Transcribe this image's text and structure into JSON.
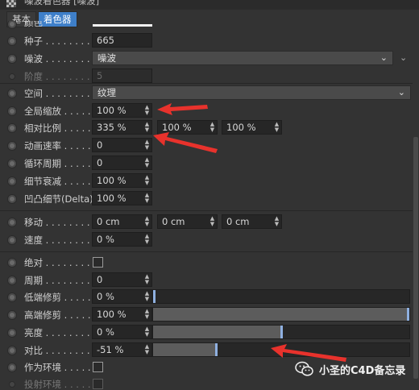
{
  "window": {
    "title": "噪波着色器 [噪波]"
  },
  "tabs": [
    {
      "label": "基本",
      "active": false
    },
    {
      "label": "着色器",
      "active": true
    }
  ],
  "params": {
    "color": {
      "label": "颜色"
    },
    "seed": {
      "label": "种子 . . . . . . . .",
      "value": "665"
    },
    "noise": {
      "label": "噪波 . . . . . . . .",
      "value": "噪波"
    },
    "octaves": {
      "label": "阶度 . . . . . . . .",
      "value": "5"
    },
    "space": {
      "label": "空间 . . . . . . . .",
      "value": "纹理"
    },
    "global_scale": {
      "label": "全局缩放 . . . . .",
      "value": "100 %"
    },
    "relative_scale": {
      "label": "相对比例 . . . . .",
      "values": [
        "335 %",
        "100 %",
        "100 %"
      ]
    },
    "anim_speed": {
      "label": "动画速率 . . . . .",
      "value": "0"
    },
    "loop_period": {
      "label": "循环周期 . . . . .",
      "value": "0"
    },
    "detail_atten": {
      "label": "细节衰减 . . . . .",
      "value": "100 %"
    },
    "delta": {
      "label": "凹凸细节(Delta)",
      "value": "100 %"
    },
    "move": {
      "label": "移动 . . . . . . . .",
      "values": [
        "0 cm",
        "0 cm",
        "0 cm"
      ]
    },
    "speed": {
      "label": "速度 . . . . . . . .",
      "value": "0 %"
    },
    "absolute": {
      "label": "绝对 . . . . . . . .",
      "checked": false
    },
    "cycles": {
      "label": "周期 . . . . . . . .",
      "value": "0"
    },
    "low_clip": {
      "label": "低端修剪 . . . . .",
      "value": "0 %",
      "level": 0
    },
    "high_clip": {
      "label": "高端修剪 . . . . .",
      "value": "100 %",
      "level": 1.0
    },
    "brightness": {
      "label": "亮度 . . . . . . . .",
      "value": "0 %",
      "level": 0.5
    },
    "contrast": {
      "label": "对比 . . . . . . . .",
      "value": "-51 %",
      "level": 0.245
    },
    "use_as_env": {
      "label": "作为环境 . . . . .",
      "checked": false
    },
    "project_env": {
      "label": "投射环境 . . . . .",
      "checked": false
    }
  },
  "watermark": {
    "text": "小圣的C4D备忘录",
    "icon": "wechat-icon"
  },
  "colors": {
    "accent": "#3e7fc9",
    "arrow": "#e8322c",
    "panel": "#333333",
    "field": "#262626"
  }
}
